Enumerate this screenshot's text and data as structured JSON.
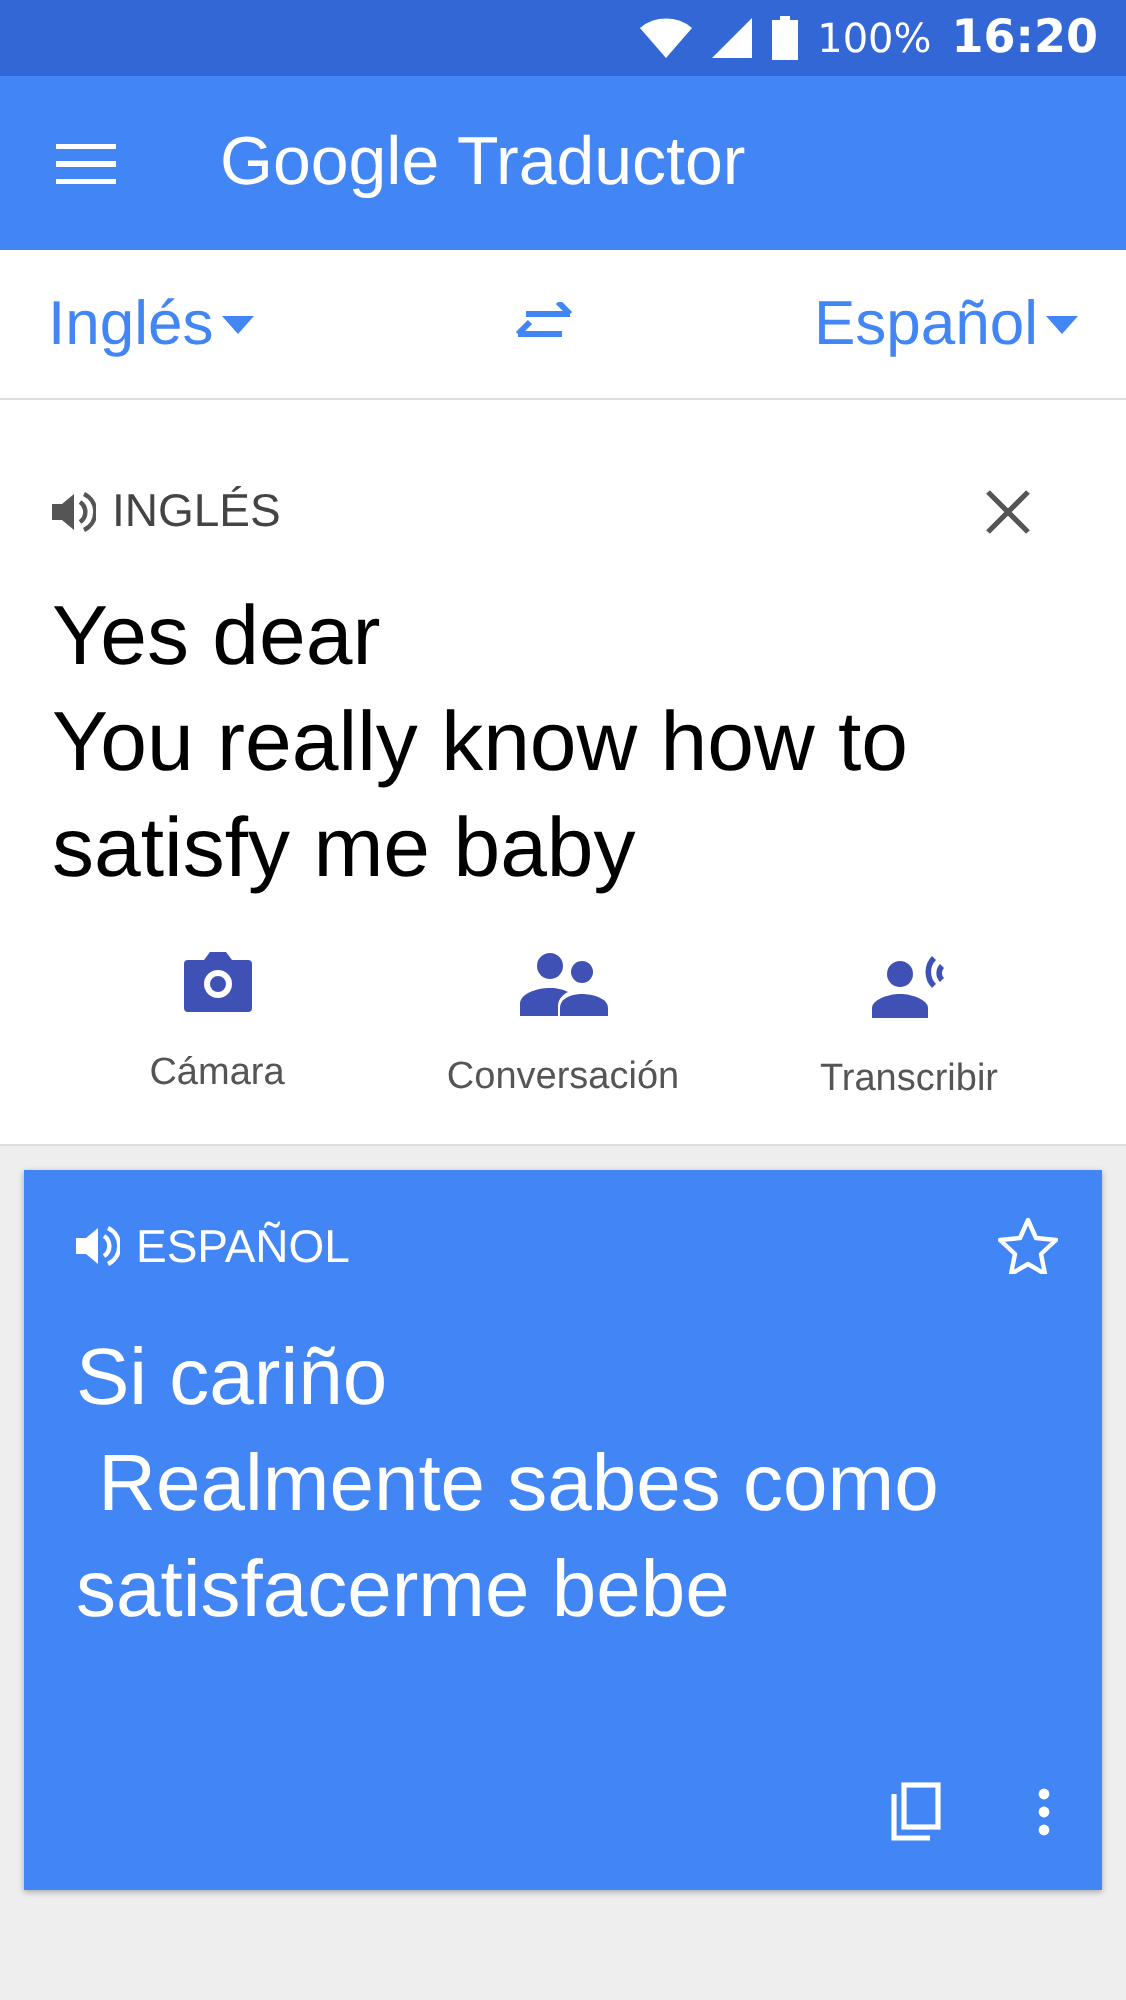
{
  "status_bar": {
    "battery": "100%",
    "time": "16:20"
  },
  "app_bar": {
    "title_brand": "Google",
    "title": "Traductor"
  },
  "languages": {
    "source": "Inglés",
    "target": "Español"
  },
  "source": {
    "language": "INGLÉS",
    "lines": [
      "Yes dear",
      "You really know how to",
      "satisfy me baby"
    ]
  },
  "tools": [
    {
      "kind": "camera",
      "label": "Cámara"
    },
    {
      "kind": "conversation",
      "label": "Conversación"
    },
    {
      "kind": "transcribe",
      "label": "Transcribir"
    }
  ],
  "translation": {
    "language": "ESPAÑOL",
    "starred": false,
    "lines": [
      "Si cariño",
      " Realmente sabes como",
      "satisfacerme bebe"
    ]
  }
}
